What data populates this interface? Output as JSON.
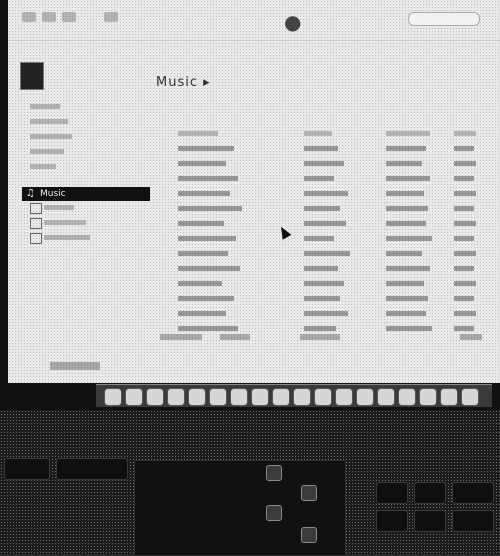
{
  "app": {
    "sidebar_selected_label": "Music",
    "sidebar_selected_icon": "music-note-icon",
    "breadcrumb_text": "Music ▸"
  },
  "sidebar": {
    "items": [
      "",
      "",
      "",
      "",
      "",
      "",
      "",
      ""
    ]
  },
  "colors": {
    "screen": "#e9e9e9",
    "selection": "#111111",
    "bezel": "#111111"
  }
}
